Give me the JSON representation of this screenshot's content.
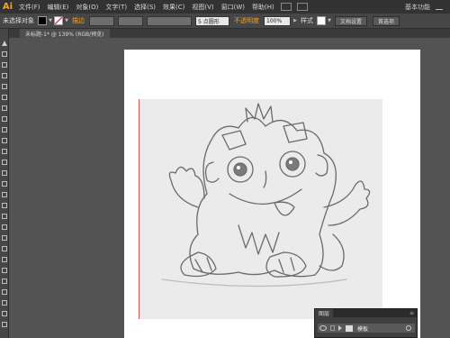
{
  "app": {
    "logo": "Ai",
    "workspace": "基本功能"
  },
  "menu": [
    "文件(F)",
    "编辑(E)",
    "对象(O)",
    "文字(T)",
    "选择(S)",
    "效果(C)",
    "视图(V)",
    "窗口(W)",
    "帮助(H)"
  ],
  "controlbar": {
    "selection": "未选择对象",
    "stroke_label": "描边",
    "brush_value": "5 点圆形",
    "opacity_label": "不透明度",
    "opacity_value": "100%",
    "style_label": "样式",
    "doc_setup": "文档设置",
    "preferences": "首选项"
  },
  "document_tab": "未标题-1* @ 139% (RGB/预览)",
  "layers": {
    "tab": "图层",
    "layer_name": "模板"
  },
  "colors": {
    "accent": "#f7a21b",
    "guide": "#d9534f"
  }
}
